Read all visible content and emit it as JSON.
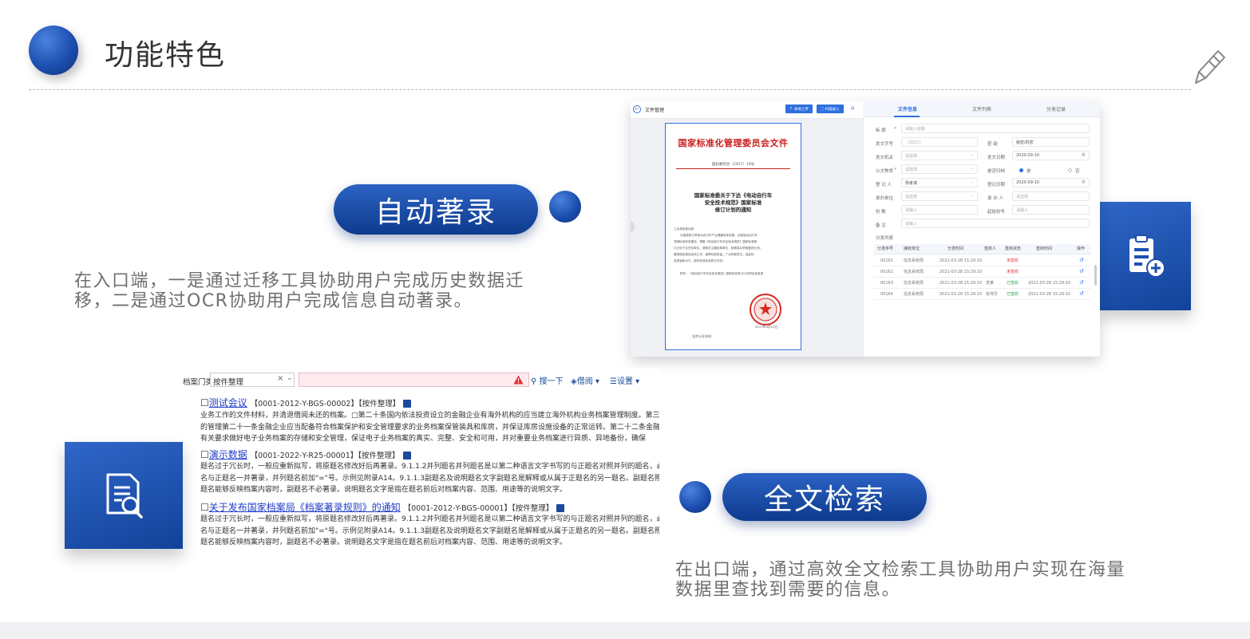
{
  "page": {
    "title": "功能特色"
  },
  "feature1": {
    "title": "自动著录",
    "desc_line1": "在入口端，一是通过迁移工具协助用户完成历史数据迁",
    "desc_line2": "移，二是通过OCR协助用户完成信息自动著录。"
  },
  "feature2": {
    "title": "全文检索",
    "desc_line1": "在出口端，通过高效全文检索工具协助用户实现在海量",
    "desc_line2": "数据里查找到需要的信息。"
  },
  "doc_app": {
    "title": "文件管理",
    "btn_upload": "本地上传",
    "btn_scan": "扫描录入",
    "doc": {
      "header": "国家标准化管理委员会文件",
      "number": "国标委综合〔2017〕19号",
      "title_l1": "国家标准委关于下达《电动自行车",
      "title_l2": "安全技术规范》国家标准",
      "title_l3": "修订计划的通知",
      "salutation": "工业和信息化部：",
      "p1": "为推进和引导电动自行车产业健康有序发展，加强电动自行车",
      "p2": "领域标准体系建设，根据《电动自行车安全技术规范》国家标准修",
      "p3": "订计划下达任务单位。请相关主管起草单位，就紧急并积极推进计划，",
      "p4": "要按规定程序加快工作，保障标准质量，广泛听取意见，保证标",
      "p5": "准质量和水平，按时完成标准修订任务。",
      "attach": "附件：《电动自行车安全技术规范》国家标准修订计划项目信息表",
      "date": "2017年4月10日",
      "footer": "（此件公开发布）"
    },
    "tabs": [
      "文件信息",
      "文件列表",
      "分发记录"
    ],
    "form": {
      "title_label": "标 题",
      "title_ph": "请输入标题",
      "wenhao_label": "发文字号",
      "wenhao_val": "〔2021〕",
      "miji_label": "密 级",
      "miji_val": "秘密/机密",
      "jiguan_label": "发文机关",
      "select_ph": "请选择",
      "riqi_label": "发文日期",
      "riqi_val": "2020-09-10",
      "zhonglei_label": "公文种类",
      "guidang_label": "是否归档",
      "yes": "是",
      "no": "否",
      "dengji_label": "登 记 人",
      "dengji_val": "杨孝谋",
      "dengji_date_label": "登记日期",
      "dengji_date_val": "2020-09-10",
      "cbdw_label": "承办单位",
      "cbr_label": "承 办 人",
      "fenshu_label": "份 数",
      "input_ph": "请输入",
      "qishi_label": "起始份号",
      "beizhu_label": "备 注",
      "list_label": "分发列表"
    },
    "table": {
      "headers": [
        "分发序号",
        "接收单位",
        "分发时间",
        "签收人",
        "签收状态",
        "签收时间",
        "操作"
      ],
      "rows": [
        {
          "no": "00161",
          "unit": "信息系统局",
          "time": "2021-03-28 15:29:10",
          "person": "",
          "status": "未签收",
          "stime": ""
        },
        {
          "no": "00162",
          "unit": "信息系统局",
          "time": "2021-03-28 15:29:10",
          "person": "",
          "status": "未签收",
          "stime": ""
        },
        {
          "no": "00163",
          "unit": "信息系统局",
          "time": "2021-03-28 15:29:10",
          "person": "李某",
          "status": "已签收",
          "stime": "2021-03-28 15:29:10"
        },
        {
          "no": "00164",
          "unit": "信息系统局",
          "time": "2021-03-28 15:29:10",
          "person": "张伟华",
          "status": "已签收",
          "stime": "2021-03-28 15:29:10"
        }
      ]
    }
  },
  "search_app": {
    "category_label": "档案门类",
    "category_value": "按件整理",
    "clear": "×",
    "search_btn": "搜一下",
    "borrow_btn": "借阅",
    "settings_btn": "设置",
    "results": [
      {
        "title": "测试会议",
        "meta": "【0001-2012-Y-BGS-00002】【按件整理】",
        "lines": [
          "业务工作的文件材料，并清退借阅未还的档案。□第二十条国内依法投资设立的金融企业有海外机构的应当建立海外机构业务档案管理制度。第三章业务档案",
          "的管理第二十一条金融企业应当配备符合档案保护和安全管理要求的业务档案保管装具和库房，并保证库房设施设备的正常运转。第二十二条金融企业应当按",
          "有关要求做好电子业务档案的存储和安全管理，保证电子业务档案的真实、完整、安全和可用，并对重要业务档案进行异质、异地备份，确保"
        ]
      },
      {
        "title": "演示数据",
        "meta": "【0001-2022-Y-R25-00001】【按件整理】",
        "lines": [
          "题名过于冗长时，一般应重新拟写，将原题名修改好后再著录。9.1.1.2并列题名并列题名是以第二种语言文字书写的与正题名对照并列的题名，必要时并列题",
          "名与正题名一并著录，并列题名前加\"=\"号。示例见附录A14。9.1.1.3副题名及说明题名文字副题名是解释或从属于正题名的另一题名。副题名照原文著录，正",
          "题名能够反映档案内容时，副题名不必著录。说明题名文字是指在题名前后对档案内容、范围、用途等的说明文字。"
        ]
      },
      {
        "title": "关于发布国家档案局《档案著录规则》的通知",
        "meta": "【0001-2012-Y-BGS-00001】【按件整理】",
        "lines": [
          "题名过于冗长时，一般应重新拟写，将原题名修改好后再著录。9.1.1.2并列题名并列题名是以第二种语言文字书写的与正题名对照并列的题名，必要时并列题",
          "名与正题名一并著录，并列题名前加\"=\"号。示例见附录A14。9.1.1.3副题名及说明题名文字副题名是解释或从属于正题名的另一题名。副题名照原文著录，正",
          "题名能够反映档案内容时，副题名不必著录。说明题名文字是指在题名前后对档案内容、范围、用途等的说明文字。"
        ]
      }
    ]
  },
  "colors": {
    "brand": "#1546a8",
    "accent_red": "#c8201e",
    "gray_text": "#6f6f6f"
  }
}
